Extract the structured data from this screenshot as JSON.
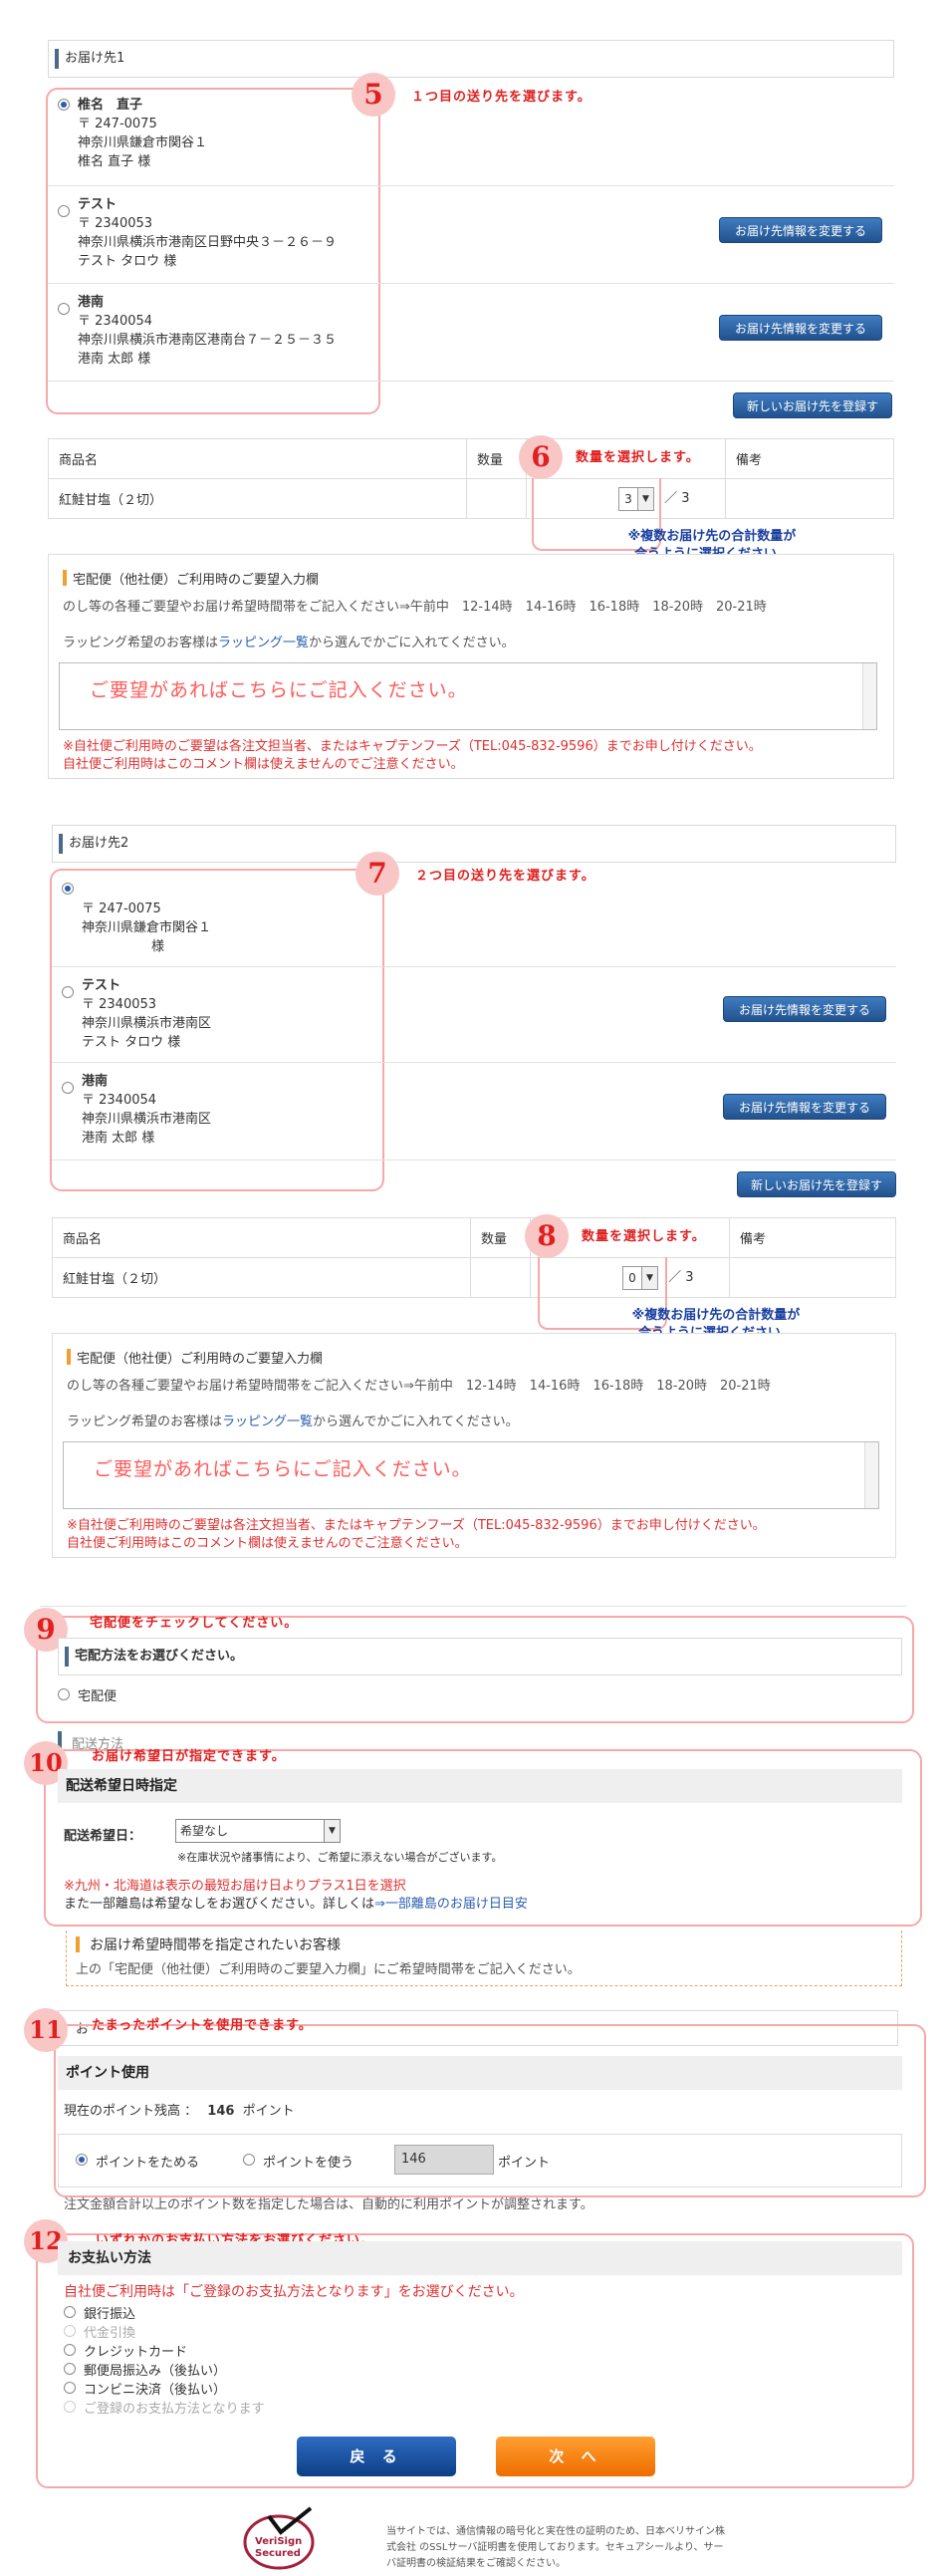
{
  "section1": {
    "title": "お届け先1",
    "step_num": "5",
    "step_note": "１つ目の送り先を選びます。",
    "addresses": [
      {
        "name": "椎名　直子",
        "zip": "〒 247-0075",
        "addr": "神奈川県鎌倉市関谷１",
        "person": "椎名 直子 様",
        "selected": true
      },
      {
        "name": "テスト",
        "zip": "〒 2340053",
        "addr": "神奈川県横浜市港南区日野中央３－２６－９",
        "person": "テスト タロウ 様",
        "selected": false
      },
      {
        "name": "港南",
        "zip": "〒 2340054",
        "addr": "神奈川県横浜市港南区港南台７－２５－３５",
        "person": "港南 太郎 様",
        "selected": false
      }
    ],
    "change_btn": "お届け先情報を変更する",
    "new_btn": "新しいお届け先を登録する",
    "goods_header": {
      "name": "商品名",
      "qty": "数量",
      "note": "備考"
    },
    "goods_row": {
      "name": "紅鮭甘塩（２切）",
      "qty": "3",
      "of": "／ 3"
    },
    "qty_step": "6",
    "qty_note": "数量を選択します。",
    "qty_note_blue": [
      "※複数お届け先の合計数量が",
      "合うように選択ください。"
    ]
  },
  "request": {
    "title": "宅配便（他社便）ご利用時のご要望入力欄",
    "line1": "のし等の各種ご要望やお届け希望時間帯をご記入ください⇒午前中　12-14時　14-16時　16-18時　18-20時　20-21時",
    "line2_pre": "ラッピング希望のお客様は",
    "line2_link": "ラッピング一覧",
    "line2_post": "から選んでかごに入れてください。",
    "placeholder": "ご要望があればこちらにご記入ください。",
    "note1": "※自社便ご利用時のご要望は各注文担当者、またはキャプテンフーズ（TEL:045-832-9596）までお申し付けください。",
    "note2": "自社便ご利用時はこのコメント欄は使えませんのでご注意ください。"
  },
  "section2": {
    "title": "お届け先2",
    "step_num": "7",
    "step_note": "２つ目の送り先を選びます。",
    "addresses": [
      {
        "name": "",
        "zip": "〒 247-0075",
        "addr": "神奈川県鎌倉市関谷１",
        "person": "様",
        "selected": true
      },
      {
        "name": "テスト",
        "zip": "〒 2340053",
        "addr": "神奈川県横浜市港南区",
        "person": "テスト タロウ 様",
        "selected": false
      },
      {
        "name": "港南",
        "zip": "〒 2340054",
        "addr": "神奈川県横浜市港南区",
        "person": "港南 太郎 様",
        "selected": false
      }
    ],
    "change_btn": "お届け先情報を変更する",
    "new_btn": "新しいお届け先を登録する",
    "goods_row": {
      "name": "紅鮭甘塩（２切）",
      "qty": "0",
      "of": "／ 3"
    },
    "qty_step": "8",
    "qty_note": "数量を選択します。"
  },
  "delivery": {
    "step_num": "9",
    "note": "宅配便をチェックしてください。",
    "title": "宅配方法をお選びください。",
    "option": "宅配便",
    "behind_title": "配送方法"
  },
  "datetime": {
    "step_num": "10",
    "note": "お届け希望日が指定できます。",
    "title": "配送希望日時指定",
    "label": "配送希望日：",
    "select_value": "希望なし",
    "small_note": "※在庫状況や諸事情により、ご希望に添えない場合がございます。",
    "kyushu1": "※九州・北海道は表示の最短お届け日よりプラス1日を選択",
    "kyushu2_pre": "また一部離島は希望なしをお選びください。詳しくは",
    "kyushu2_link": "⇒一部離島のお届け日目安",
    "time_title": "お届け希望時間帯を指定されたいお客様",
    "time_text": "上の「宅配便（他社便）ご利用時のご要望入力欄」にご希望時間帯をご記入ください。"
  },
  "points": {
    "step_num": "11",
    "note": "たまったポイントを使用できます。",
    "behind_title": "お",
    "title": "ポイント使用",
    "balance_label": "現在のポイント残高 ：",
    "balance_value": "146",
    "balance_unit": "ポイント",
    "opt_save": "ポイントをためる",
    "opt_use": "ポイントを使う",
    "input_value": "146",
    "input_unit": "ポイント",
    "footnote": "注文金額合計以上のポイント数を指定した場合は、自動的に利用ポイントが調整されます。"
  },
  "payment": {
    "step_num": "12",
    "note": "いずれかのお支払い方法をお選びください。",
    "title": "お支払い方法",
    "red_note": "自社便ご利用時は「ご登録のお支払方法となります」をお選びください。",
    "methods": [
      {
        "label": "銀行振込",
        "disabled": false
      },
      {
        "label": "代金引換",
        "disabled": true
      },
      {
        "label": "クレジットカード",
        "disabled": false
      },
      {
        "label": "郵便局振込み（後払い）",
        "disabled": false
      },
      {
        "label": "コンビニ決済（後払い）",
        "disabled": false
      },
      {
        "label": "ご登録のお支払方法となります",
        "disabled": true
      }
    ]
  },
  "nav": {
    "back": "戻 る",
    "next": "次 へ"
  },
  "footer": {
    "seal_line1": "VeriSign",
    "seal_line2": "Secured",
    "text": "当サイトでは、通信情報の暗号化と実在性の証明のため、日本ベリサイン株式会社 のSSLサーバ証明書を使用しております。セキュアシールより、サーバ証明書の検証結果をご確認ください。"
  },
  "colors": {
    "accent_red": "#e02020",
    "button_blue": "#2a5d9f",
    "next_orange": "#f28a1a"
  }
}
